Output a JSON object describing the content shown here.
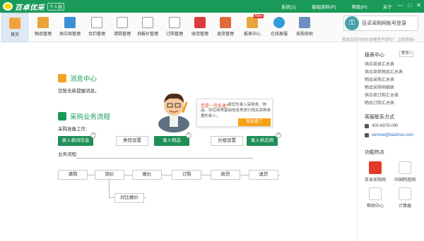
{
  "app": {
    "logo_text": "百卓优采",
    "edition": "个人版"
  },
  "topmenu": [
    "系统(1)",
    "基础资料(P)",
    "帮助(H)",
    "关于"
  ],
  "window": {
    "min": "—",
    "max": "□",
    "close": "✕"
  },
  "toolbar": {
    "items": [
      {
        "label": "首页",
        "name": "home"
      },
      {
        "label": "物品管理",
        "name": "goods"
      },
      {
        "label": "供应商管理",
        "name": "supplier"
      },
      {
        "label": "合约管理",
        "name": "contract"
      },
      {
        "label": "请购管理",
        "name": "requisition"
      },
      {
        "label": "询报价管理",
        "name": "quote"
      },
      {
        "label": "订购管理",
        "name": "order"
      },
      {
        "label": "收货管理",
        "name": "receive"
      },
      {
        "label": "退货管理",
        "name": "return"
      },
      {
        "label": "报表中心",
        "name": "report",
        "badge": "New"
      },
      {
        "label": "在线客服",
        "name": "service"
      },
      {
        "label": "采购协助",
        "name": "assist"
      }
    ],
    "register_label": "百卓采购网帐号登录",
    "register_hint": "登录后实时询价单哪里不找吗？ 立即登录>"
  },
  "message": {
    "title": "消息中心",
    "empty": "您暂无新提醒消息。"
  },
  "process": {
    "title": "采购业务流程",
    "prep_label": "采购准备工作:",
    "prep_buttons": {
      "goods": "录入表间信息",
      "category": "类目设置",
      "record_goods": "录入物品",
      "grouping": "分组设置",
      "record_supplier": "录入供应商"
    },
    "flow_label": "业务流程:",
    "flow_steps": [
      "请购",
      "询价",
      "报价",
      "订购",
      "收货",
      "退货"
    ],
    "compare": "对比报价"
  },
  "tip": {
    "question": "您是一劳永逸?",
    "text": "请您先录入采购类、物品、供应商等基础信息再进行相关采购单据的录入。",
    "ok": "我知道了"
  },
  "right": {
    "report_title": "报表中心",
    "more": "更多>",
    "reports": [
      "供应商供汇总表",
      "供应商供物品汇总表",
      "物品采购汇总表",
      "物品采购明细表",
      "供应商订购汇总表",
      "物品订购汇总表"
    ],
    "contact_title": "客服联系方式",
    "phone": "400-6979-090",
    "email": "service@baizhuo.com",
    "hot_title": "功能热点",
    "hot_items": [
      "百卓采购网",
      "中国制造网",
      "帮助中心",
      "计算器"
    ]
  },
  "colors": {
    "brand": "#1a9a59",
    "button_green": "#1f8f55",
    "accent_orange": "#f5a015"
  }
}
